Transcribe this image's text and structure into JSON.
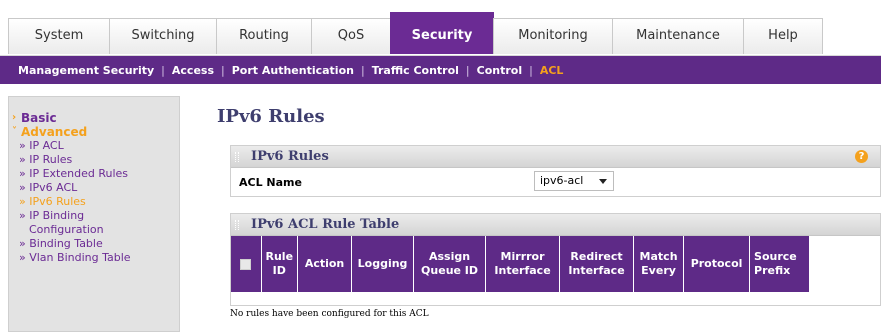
{
  "top_tabs": [
    {
      "label": "System"
    },
    {
      "label": "Switching"
    },
    {
      "label": "Routing"
    },
    {
      "label": "QoS"
    },
    {
      "label": "Security"
    },
    {
      "label": "Monitoring"
    },
    {
      "label": "Maintenance"
    },
    {
      "label": "Help"
    }
  ],
  "sub_nav": [
    {
      "label": "Management Security"
    },
    {
      "label": "Access"
    },
    {
      "label": "Port Authentication"
    },
    {
      "label": "Traffic Control"
    },
    {
      "label": "Control"
    },
    {
      "label": "ACL"
    }
  ],
  "sidebar": {
    "basic": "Basic",
    "advanced": "Advanced",
    "items": [
      "» IP ACL",
      "» IP Rules",
      "» IP Extended Rules",
      "» IPv6 ACL",
      "» IPv6 Rules",
      "» IP Binding",
      "Configuration",
      "» Binding Table",
      "» Vlan Binding Table"
    ]
  },
  "page_title": "IPv6 Rules",
  "rules_panel": {
    "title": "IPv6 Rules",
    "acl_name_label": "ACL Name",
    "acl_name_value": "ipv6-acl",
    "help_icon_glyph": "?"
  },
  "table_panel": {
    "title": "IPv6 ACL Rule Table",
    "headers": [
      [
        "Rule",
        "ID"
      ],
      [
        "Action"
      ],
      [
        "Logging"
      ],
      [
        "Assign",
        "Queue ID"
      ],
      [
        "Mirrror",
        "Interface"
      ],
      [
        "Redirect",
        "Interface"
      ],
      [
        "Match",
        "Every"
      ],
      [
        "Protocol"
      ],
      [
        "Source",
        "Prefix"
      ]
    ],
    "empty_message": "No rules have been configured for this ACL"
  },
  "colors": {
    "brand_purple": "#6b2b94",
    "subnav_purple": "#5e2a87",
    "accent_orange": "#f4a11d"
  }
}
